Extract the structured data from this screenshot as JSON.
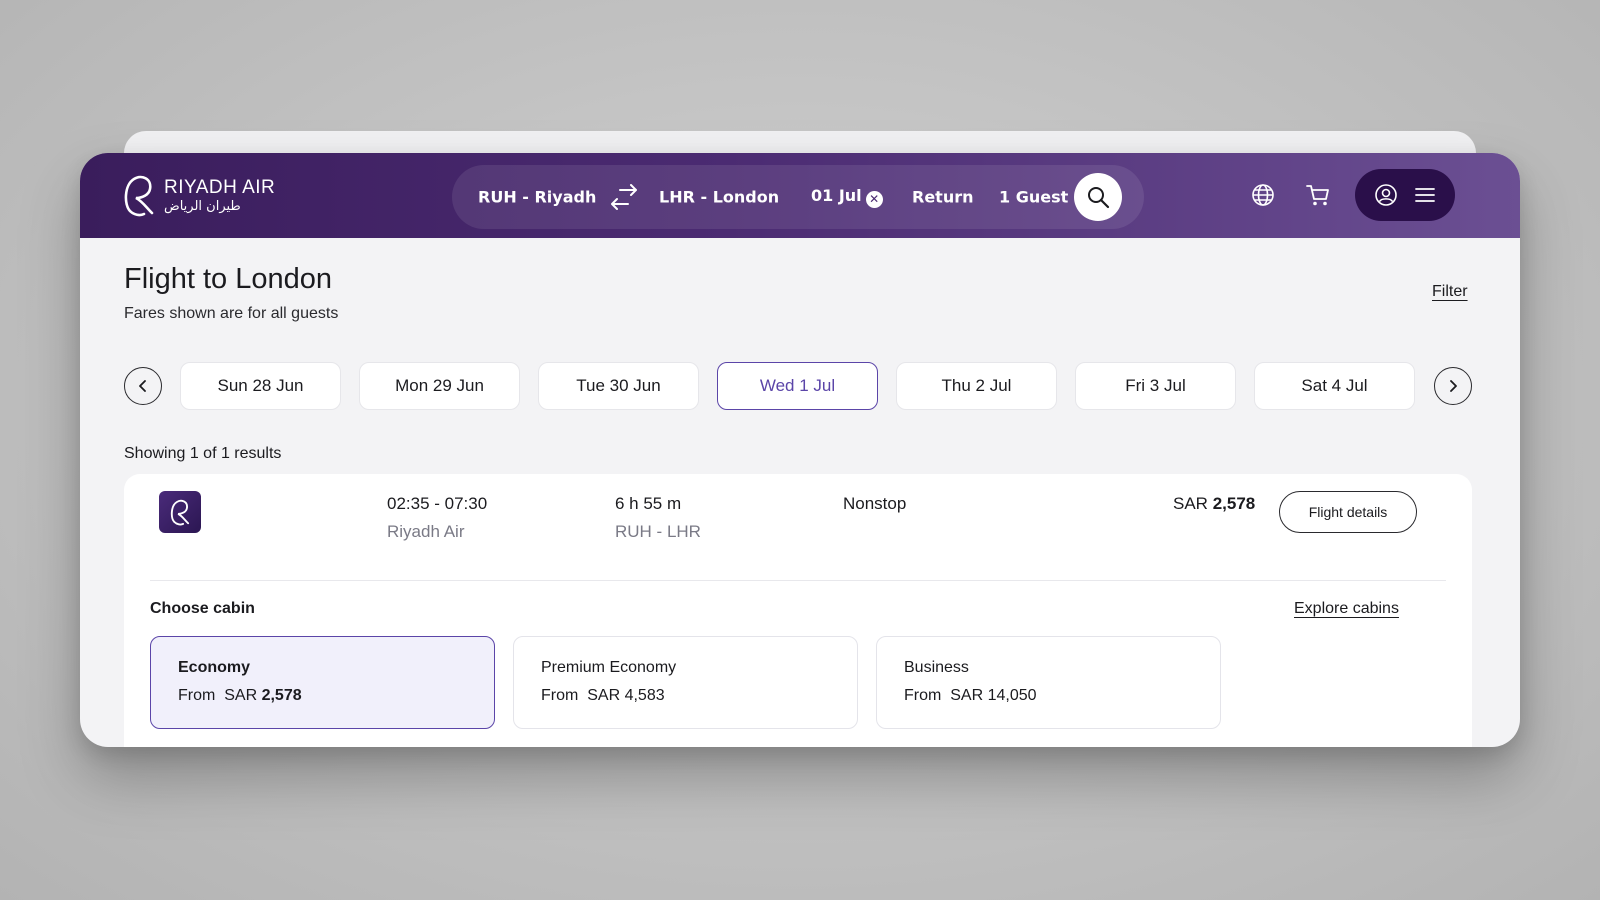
{
  "brand": {
    "name_en": "RIYADH AIR",
    "name_ar": "طيران الرياض"
  },
  "search": {
    "origin": "RUH - Riyadh",
    "destination": "LHR - London",
    "date": "01 Jul",
    "trip_type": "Return",
    "guests": "1 Guest"
  },
  "page": {
    "title": "Flight to London",
    "subtitle": "Fares shown are for all guests",
    "filter_label": "Filter",
    "results_count": "Showing 1 of 1 results"
  },
  "dates": [
    {
      "label": "Sun 28 Jun",
      "selected": false
    },
    {
      "label": "Mon 29 Jun",
      "selected": false
    },
    {
      "label": "Tue 30 Jun",
      "selected": false
    },
    {
      "label": "Wed 1 Jul",
      "selected": true
    },
    {
      "label": "Thu 2 Jul",
      "selected": false
    },
    {
      "label": "Fri 3 Jul",
      "selected": false
    },
    {
      "label": "Sat 4 Jul",
      "selected": false
    }
  ],
  "flight": {
    "times": "02:35 - 07:30",
    "airline": "Riyadh Air",
    "duration": "6 h 55 m",
    "route": "RUH - LHR",
    "stops": "Nonstop",
    "currency": "SAR",
    "price": "2,578",
    "details_label": "Flight details"
  },
  "cabins": {
    "heading": "Choose cabin",
    "explore_label": "Explore cabins",
    "from_label": "From",
    "items": [
      {
        "name": "Economy",
        "currency": "SAR",
        "price": "2,578",
        "selected": true
      },
      {
        "name": "Premium Economy",
        "currency": "SAR",
        "price": "4,583",
        "selected": false
      },
      {
        "name": "Business",
        "currency": "SAR",
        "price": "14,050",
        "selected": false
      }
    ]
  },
  "colors": {
    "header_start": "#3a1d5c",
    "header_end": "#6b4f93",
    "accent": "#5b45a8",
    "account_pill": "#2a0f4a"
  },
  "icons": [
    "logo-mark-icon",
    "swap-icon",
    "clear-icon",
    "search-icon",
    "globe-icon",
    "cart-icon",
    "user-icon",
    "menu-icon",
    "chevron-left-icon",
    "chevron-right-icon",
    "airline-logo-icon"
  ]
}
